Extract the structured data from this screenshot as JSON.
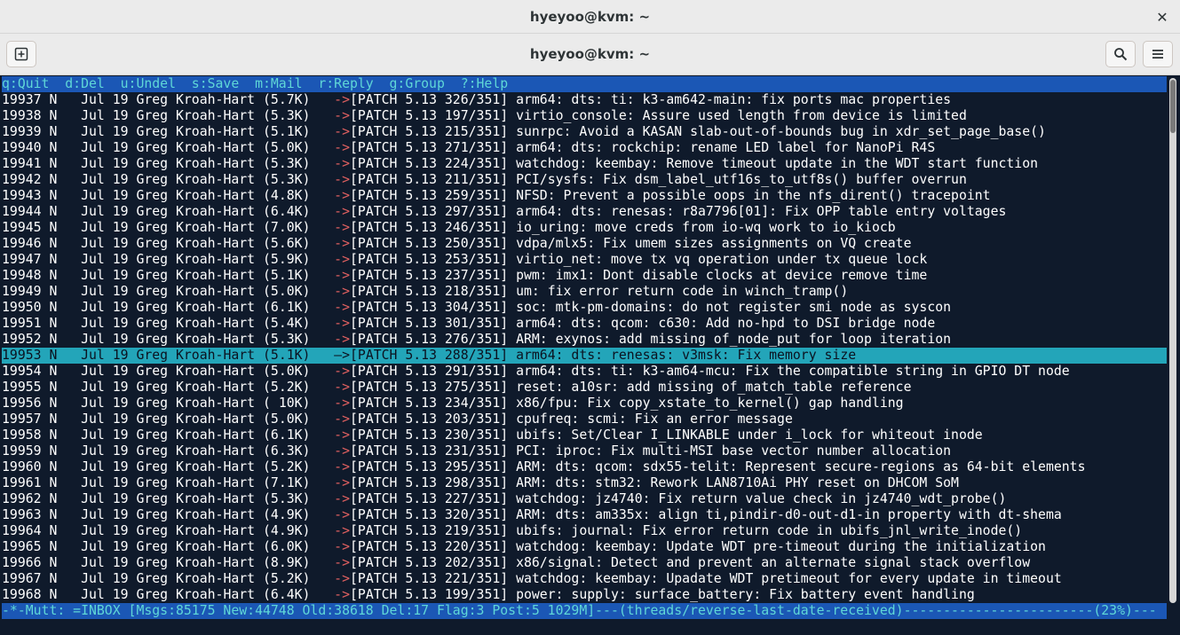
{
  "window": {
    "title": "hyeyoo@kvm: ~",
    "header_title": "hyeyoo@kvm: ~",
    "close_glyph": "✕"
  },
  "icons": {
    "new_tab": "new-tab-icon",
    "search": "search-icon",
    "menu": "hamburger-menu-icon",
    "close": "close-icon"
  },
  "colors": {
    "help_bg": "#1b57b5",
    "help_fg": "#5fd7d7",
    "selected_bg": "#23a5b9",
    "arrow": "#e06060",
    "terminal_bg": "#0f1a2b"
  },
  "help_bar": "q:Quit  d:Del  u:Undel  s:Save  m:Mail  r:Reply  g:Group  ?:Help",
  "messages": [
    {
      "num": "19937",
      "flag": "N",
      "date": "Jul 19",
      "from": "Greg Kroah-Hart",
      "size": "(5.7K)",
      "arrow": "->",
      "subject": "[PATCH 5.13 326/351] arm64: dts: ti: k3-am642-main: fix ports mac properties"
    },
    {
      "num": "19938",
      "flag": "N",
      "date": "Jul 19",
      "from": "Greg Kroah-Hart",
      "size": "(5.3K)",
      "arrow": "->",
      "subject": "[PATCH 5.13 197/351] virtio_console: Assure used length from device is limited"
    },
    {
      "num": "19939",
      "flag": "N",
      "date": "Jul 19",
      "from": "Greg Kroah-Hart",
      "size": "(5.1K)",
      "arrow": "->",
      "subject": "[PATCH 5.13 215/351] sunrpc: Avoid a KASAN slab-out-of-bounds bug in xdr_set_page_base()"
    },
    {
      "num": "19940",
      "flag": "N",
      "date": "Jul 19",
      "from": "Greg Kroah-Hart",
      "size": "(5.0K)",
      "arrow": "->",
      "subject": "[PATCH 5.13 271/351] arm64: dts: rockchip: rename LED label for NanoPi R4S"
    },
    {
      "num": "19941",
      "flag": "N",
      "date": "Jul 19",
      "from": "Greg Kroah-Hart",
      "size": "(5.3K)",
      "arrow": "->",
      "subject": "[PATCH 5.13 224/351] watchdog: keembay: Remove timeout update in the WDT start function"
    },
    {
      "num": "19942",
      "flag": "N",
      "date": "Jul 19",
      "from": "Greg Kroah-Hart",
      "size": "(5.3K)",
      "arrow": "->",
      "subject": "[PATCH 5.13 211/351] PCI/sysfs: Fix dsm_label_utf16s_to_utf8s() buffer overrun"
    },
    {
      "num": "19943",
      "flag": "N",
      "date": "Jul 19",
      "from": "Greg Kroah-Hart",
      "size": "(4.8K)",
      "arrow": "->",
      "subject": "[PATCH 5.13 259/351] NFSD: Prevent a possible oops in the nfs_dirent() tracepoint"
    },
    {
      "num": "19944",
      "flag": "N",
      "date": "Jul 19",
      "from": "Greg Kroah-Hart",
      "size": "(6.4K)",
      "arrow": "->",
      "subject": "[PATCH 5.13 297/351] arm64: dts: renesas: r8a7796[01]: Fix OPP table entry voltages"
    },
    {
      "num": "19945",
      "flag": "N",
      "date": "Jul 19",
      "from": "Greg Kroah-Hart",
      "size": "(7.0K)",
      "arrow": "->",
      "subject": "[PATCH 5.13 246/351] io_uring: move creds from io-wq work to io_kiocb"
    },
    {
      "num": "19946",
      "flag": "N",
      "date": "Jul 19",
      "from": "Greg Kroah-Hart",
      "size": "(5.6K)",
      "arrow": "->",
      "subject": "[PATCH 5.13 250/351] vdpa/mlx5: Fix umem sizes assignments on VQ create"
    },
    {
      "num": "19947",
      "flag": "N",
      "date": "Jul 19",
      "from": "Greg Kroah-Hart",
      "size": "(5.9K)",
      "arrow": "->",
      "subject": "[PATCH 5.13 253/351] virtio_net: move tx vq operation under tx queue lock"
    },
    {
      "num": "19948",
      "flag": "N",
      "date": "Jul 19",
      "from": "Greg Kroah-Hart",
      "size": "(5.1K)",
      "arrow": "->",
      "subject": "[PATCH 5.13 237/351] pwm: imx1: Dont disable clocks at device remove time"
    },
    {
      "num": "19949",
      "flag": "N",
      "date": "Jul 19",
      "from": "Greg Kroah-Hart",
      "size": "(5.0K)",
      "arrow": "->",
      "subject": "[PATCH 5.13 218/351] um: fix error return code in winch_tramp()"
    },
    {
      "num": "19950",
      "flag": "N",
      "date": "Jul 19",
      "from": "Greg Kroah-Hart",
      "size": "(6.1K)",
      "arrow": "->",
      "subject": "[PATCH 5.13 304/351] soc: mtk-pm-domains: do not register smi node as syscon"
    },
    {
      "num": "19951",
      "flag": "N",
      "date": "Jul 19",
      "from": "Greg Kroah-Hart",
      "size": "(5.4K)",
      "arrow": "->",
      "subject": "[PATCH 5.13 301/351] arm64: dts: qcom: c630: Add no-hpd to DSI bridge node"
    },
    {
      "num": "19952",
      "flag": "N",
      "date": "Jul 19",
      "from": "Greg Kroah-Hart",
      "size": "(5.3K)",
      "arrow": "->",
      "subject": "[PATCH 5.13 276/351] ARM: exynos: add missing of_node_put for loop iteration"
    },
    {
      "num": "19953",
      "flag": "N",
      "date": "Jul 19",
      "from": "Greg Kroah-Hart",
      "size": "(5.1K)",
      "arrow": "->",
      "subject": "[PATCH 5.13 288/351] arm64: dts: renesas: v3msk: Fix memory size",
      "selected": true
    },
    {
      "num": "19954",
      "flag": "N",
      "date": "Jul 19",
      "from": "Greg Kroah-Hart",
      "size": "(5.0K)",
      "arrow": "->",
      "subject": "[PATCH 5.13 291/351] arm64: dts: ti: k3-am64-mcu: Fix the compatible string in GPIO DT node"
    },
    {
      "num": "19955",
      "flag": "N",
      "date": "Jul 19",
      "from": "Greg Kroah-Hart",
      "size": "(5.2K)",
      "arrow": "->",
      "subject": "[PATCH 5.13 275/351] reset: a10sr: add missing of_match_table reference"
    },
    {
      "num": "19956",
      "flag": "N",
      "date": "Jul 19",
      "from": "Greg Kroah-Hart",
      "size": "( 10K)",
      "arrow": "->",
      "subject": "[PATCH 5.13 234/351] x86/fpu: Fix copy_xstate_to_kernel() gap handling"
    },
    {
      "num": "19957",
      "flag": "N",
      "date": "Jul 19",
      "from": "Greg Kroah-Hart",
      "size": "(5.0K)",
      "arrow": "->",
      "subject": "[PATCH 5.13 203/351] cpufreq: scmi: Fix an error message"
    },
    {
      "num": "19958",
      "flag": "N",
      "date": "Jul 19",
      "from": "Greg Kroah-Hart",
      "size": "(6.1K)",
      "arrow": "->",
      "subject": "[PATCH 5.13 230/351] ubifs: Set/Clear I_LINKABLE under i_lock for whiteout inode"
    },
    {
      "num": "19959",
      "flag": "N",
      "date": "Jul 19",
      "from": "Greg Kroah-Hart",
      "size": "(6.3K)",
      "arrow": "->",
      "subject": "[PATCH 5.13 231/351] PCI: iproc: Fix multi-MSI base vector number allocation"
    },
    {
      "num": "19960",
      "flag": "N",
      "date": "Jul 19",
      "from": "Greg Kroah-Hart",
      "size": "(5.2K)",
      "arrow": "->",
      "subject": "[PATCH 5.13 295/351] ARM: dts: qcom: sdx55-telit: Represent secure-regions as 64-bit elements"
    },
    {
      "num": "19961",
      "flag": "N",
      "date": "Jul 19",
      "from": "Greg Kroah-Hart",
      "size": "(7.1K)",
      "arrow": "->",
      "subject": "[PATCH 5.13 298/351] ARM: dts: stm32: Rework LAN8710Ai PHY reset on DHCOM SoM"
    },
    {
      "num": "19962",
      "flag": "N",
      "date": "Jul 19",
      "from": "Greg Kroah-Hart",
      "size": "(5.3K)",
      "arrow": "->",
      "subject": "[PATCH 5.13 227/351] watchdog: jz4740: Fix return value check in jz4740_wdt_probe()"
    },
    {
      "num": "19963",
      "flag": "N",
      "date": "Jul 19",
      "from": "Greg Kroah-Hart",
      "size": "(4.9K)",
      "arrow": "->",
      "subject": "[PATCH 5.13 320/351] ARM: dts: am335x: align ti,pindir-d0-out-d1-in property with dt-shema"
    },
    {
      "num": "19964",
      "flag": "N",
      "date": "Jul 19",
      "from": "Greg Kroah-Hart",
      "size": "(4.9K)",
      "arrow": "->",
      "subject": "[PATCH 5.13 219/351] ubifs: journal: Fix error return code in ubifs_jnl_write_inode()"
    },
    {
      "num": "19965",
      "flag": "N",
      "date": "Jul 19",
      "from": "Greg Kroah-Hart",
      "size": "(6.0K)",
      "arrow": "->",
      "subject": "[PATCH 5.13 220/351] watchdog: keembay: Update WDT pre-timeout during the initialization"
    },
    {
      "num": "19966",
      "flag": "N",
      "date": "Jul 19",
      "from": "Greg Kroah-Hart",
      "size": "(8.9K)",
      "arrow": "->",
      "subject": "[PATCH 5.13 202/351] x86/signal: Detect and prevent an alternate signal stack overflow"
    },
    {
      "num": "19967",
      "flag": "N",
      "date": "Jul 19",
      "from": "Greg Kroah-Hart",
      "size": "(5.2K)",
      "arrow": "->",
      "subject": "[PATCH 5.13 221/351] watchdog: keembay: Upadate WDT pretimeout for every update in timeout"
    },
    {
      "num": "19968",
      "flag": "N",
      "date": "Jul 19",
      "from": "Greg Kroah-Hart",
      "size": "(6.4K)",
      "arrow": "->",
      "subject": "[PATCH 5.13 199/351] power: supply: surface_battery: Fix battery event handling"
    }
  ],
  "status_bar": "-*-Mutt: =INBOX [Msgs:85175 New:44748 Old:38618 Del:17 Flag:3 Post:5 1029M]---(threads/reverse-last-date-received)------------------------(23%)---",
  "scroll": {
    "position_fraction": 0.23
  }
}
